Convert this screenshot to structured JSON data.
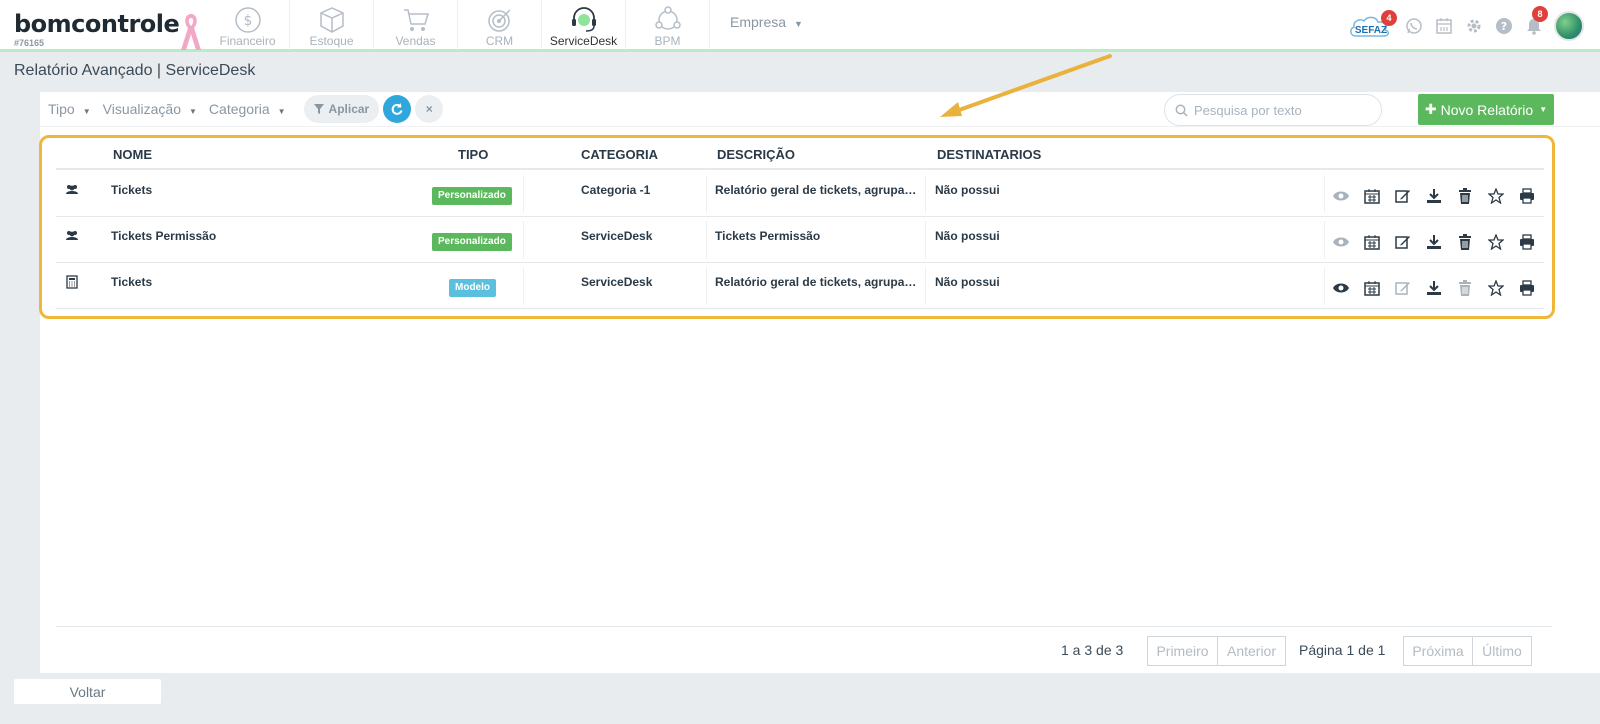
{
  "app": {
    "logo": "bomcontrole",
    "account_id": "#76165"
  },
  "modules": [
    {
      "label": "Financeiro",
      "icon": "dollar-circle-icon",
      "active": false
    },
    {
      "label": "Estoque",
      "icon": "box-icon",
      "active": false
    },
    {
      "label": "Vendas",
      "icon": "cart-icon",
      "active": false
    },
    {
      "label": "CRM",
      "icon": "target-icon",
      "active": false
    },
    {
      "label": "ServiceDesk",
      "icon": "headset-icon",
      "active": true
    },
    {
      "label": "BPM",
      "icon": "process-icon",
      "active": false
    }
  ],
  "empresa_label": "Empresa",
  "header_right": {
    "sefaz_label": "SEFAZ",
    "sefaz_badge": "4",
    "notifications_badge": "8"
  },
  "page": {
    "title": "Relatório Avançado | ServiceDesk"
  },
  "filters": {
    "tipo": "Tipo",
    "visualizacao": "Visualização",
    "categoria": "Categoria",
    "aplicar": "Aplicar",
    "clear": "×"
  },
  "search": {
    "placeholder": "Pesquisa por texto",
    "value": ""
  },
  "new_report_button": "Novo Relatório",
  "table": {
    "columns": [
      "NOME",
      "TIPO",
      "CATEGORIA",
      "DESCRIÇÃO",
      "DESTINATARIOS"
    ],
    "rows": [
      {
        "icon": "users-icon",
        "nome": "Tickets",
        "tipo": "Personalizado",
        "tipo_color": "green",
        "categoria": "Categoria -1",
        "descricao": "Relatório geral de tickets, agrupad...",
        "destinatarios": "Não possui"
      },
      {
        "icon": "users-icon",
        "nome": "Tickets Permissão",
        "tipo": "Personalizado",
        "tipo_color": "green",
        "categoria": "ServiceDesk",
        "descricao": "Tickets Permissão",
        "destinatarios": "Não possui"
      },
      {
        "icon": "calculator-icon",
        "nome": "Tickets",
        "tipo": "Modelo",
        "tipo_color": "blue",
        "categoria": "ServiceDesk",
        "descricao": "Relatório geral de tickets, agrupad...",
        "destinatarios": "Não possui"
      }
    ]
  },
  "pagination": {
    "summary": "1 a 3 de 3",
    "first": "Primeiro",
    "previous": "Anterior",
    "page_label": "Página 1 de 1",
    "next": "Próxima",
    "last": "Último"
  },
  "back_button": "Voltar",
  "colors": {
    "accent_green": "#5cb85c",
    "accent_blue": "#2fa6dc",
    "highlight": "#f0b63a",
    "tag_blue": "#5bc0de"
  }
}
